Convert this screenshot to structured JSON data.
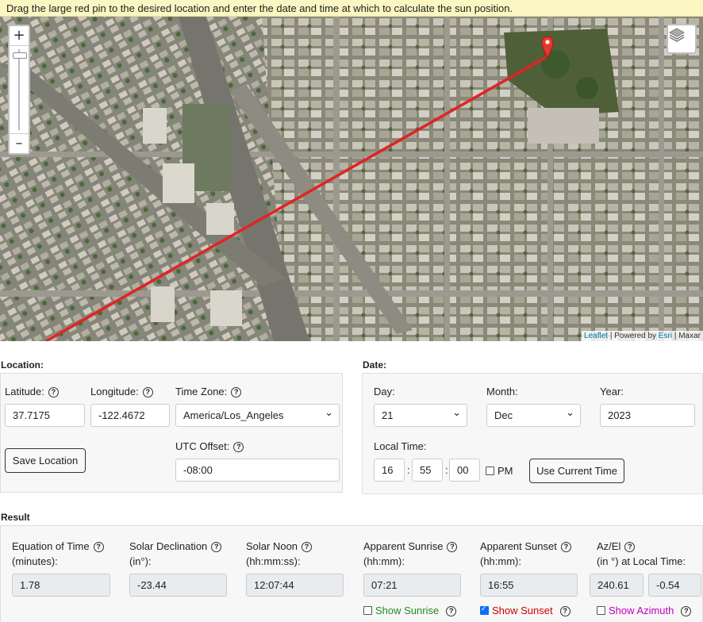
{
  "banner": "Drag the large red pin to the desired location and enter the date and time at which to calculate the sun position.",
  "map": {
    "zoom_in": "+",
    "zoom_out": "–",
    "attribution": {
      "leaflet": "Leaflet",
      "separator1": " | Powered by ",
      "esri": "Esri",
      "separator2": " | Maxar"
    },
    "pin_color": "#e8362b",
    "line_color": "#e02424"
  },
  "location": {
    "title": "Location:",
    "latitude_label": "Latitude:",
    "latitude": "37.7175",
    "longitude_label": "Longitude:",
    "longitude": "-122.4672",
    "timezone_label": "Time Zone:",
    "timezone": "America/Los_Angeles",
    "utc_label": "UTC Offset:",
    "utc": "-08:00",
    "save_button": "Save Location"
  },
  "date": {
    "title": "Date:",
    "day_label": "Day:",
    "day": "21",
    "month_label": "Month:",
    "month": "Dec",
    "year_label": "Year:",
    "year": "2023",
    "time_label": "Local Time:",
    "hour": "16",
    "minute": "55",
    "second": "00",
    "colon": ":",
    "pm_label": "PM",
    "current_button": "Use Current Time"
  },
  "result": {
    "title": "Result",
    "eot_label": "Equation of Time",
    "eot_unit": "(minutes):",
    "eot": "1.78",
    "decl_label": "Solar Declination",
    "decl_unit": "(in°):",
    "decl": "-23.44",
    "noon_label": "Solar Noon",
    "noon_unit": "(hh:mm:ss):",
    "noon": "12:07:44",
    "sunrise_label": "Apparent Sunrise",
    "sunrise_unit": "(hh:mm):",
    "sunrise": "07:21",
    "sunset_label": "Apparent Sunset",
    "sunset_unit": "(hh:mm):",
    "sunset": "16:55",
    "azel_label": "Az/El",
    "azel_unit": "(in °) at Local Time:",
    "az": "240.61",
    "el": "-0.54",
    "show_sunrise": "Show Sunrise",
    "show_sunset": "Show Sunset",
    "show_azimuth": "Show Azimuth",
    "sunrise_color": "#228b22",
    "sunset_color": "#cc0000",
    "azimuth_color": "#c000c0",
    "show_sunrise_checked": false,
    "show_sunset_checked": true,
    "show_azimuth_checked": false
  }
}
